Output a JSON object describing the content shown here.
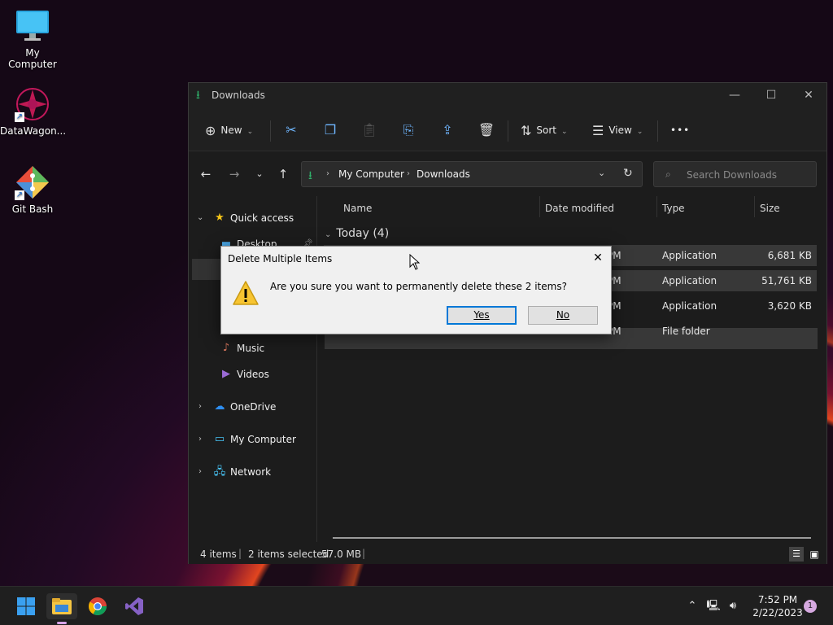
{
  "desktop": {
    "icons": [
      {
        "label": "My Computer",
        "icon": "monitor-icon"
      },
      {
        "label": "DataWagon...",
        "icon": "datawagon-icon"
      },
      {
        "label": "Git Bash",
        "icon": "git-icon"
      }
    ]
  },
  "explorer": {
    "title": "Downloads",
    "toolbar": {
      "new_label": "New",
      "sort_label": "Sort",
      "view_label": "View",
      "more_glyph": "•••"
    },
    "address": {
      "crumbs": [
        "My Computer",
        "Downloads"
      ],
      "search_placeholder": "Search Downloads"
    },
    "sidebar": {
      "quick_access": "Quick access",
      "items": [
        "Desktop",
        "Music",
        "Videos"
      ],
      "onedrive": "OneDrive",
      "my_computer": "My Computer",
      "network": "Network"
    },
    "columns": {
      "name": "Name",
      "date": "Date modified",
      "type": "Type",
      "size": "Size"
    },
    "group_header": "Today (4)",
    "rows": [
      {
        "date": "PM",
        "type": "Application",
        "size": "6,681 KB",
        "selected": true
      },
      {
        "date": "PM",
        "type": "Application",
        "size": "51,761 KB",
        "selected": true
      },
      {
        "date": "PM",
        "type": "Application",
        "size": "3,620 KB",
        "selected": false
      },
      {
        "date": "PM",
        "type": "File folder",
        "size": "",
        "selected": false
      }
    ],
    "status": {
      "count": "4 items",
      "selection": "2 items selected",
      "size": "57.0 MB"
    }
  },
  "dialog": {
    "title": "Delete Multiple Items",
    "message": "Are you sure you want to permanently delete these 2 items?",
    "yes_label": "Yes",
    "no_label": "No"
  },
  "taskbar": {
    "time": "7:52 PM",
    "date": "2/22/2023",
    "notification_count": "1"
  },
  "colors": {
    "accent": "#0078d7",
    "folder_blue": "#6fb6ff",
    "download_green": "#2fb36b"
  }
}
